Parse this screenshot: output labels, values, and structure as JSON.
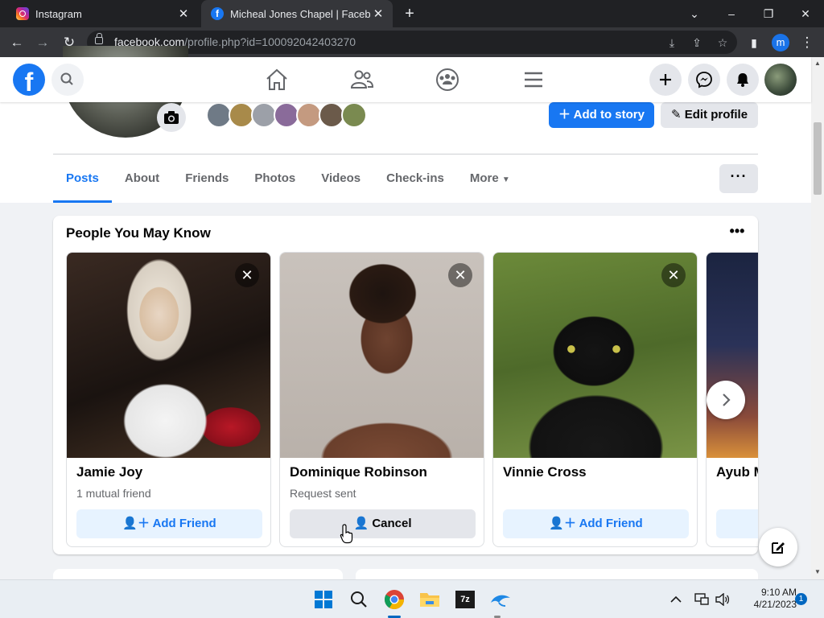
{
  "browser": {
    "tabs": [
      {
        "title": "Instagram"
      },
      {
        "title": "Micheal Jones Chapel | Facebook"
      }
    ],
    "url_host": "facebook.com",
    "url_path": "/profile.php?id=100092042403270",
    "profile_initial": "m"
  },
  "profile": {
    "add_story_label": "Add to story",
    "edit_profile_label": "Edit profile",
    "tabs": [
      "Posts",
      "About",
      "Friends",
      "Photos",
      "Videos",
      "Check-ins",
      "More"
    ],
    "active_tab": "Posts",
    "more_dots": "···"
  },
  "pymk": {
    "title": "People You May Know",
    "people": [
      {
        "name": "Jamie Joy",
        "subtitle": "1 mutual friend",
        "button": "Add Friend",
        "state": "add"
      },
      {
        "name": "Dominique Robinson",
        "subtitle": "Request sent",
        "button": "Cancel",
        "state": "cancel"
      },
      {
        "name": "Vinnie Cross",
        "subtitle": "",
        "button": "Add Friend",
        "state": "add"
      },
      {
        "name": "Ayub M",
        "subtitle": "",
        "button": "",
        "state": "add"
      }
    ]
  },
  "taskbar": {
    "time": "9:10 AM",
    "date": "4/21/2023",
    "notifications": "1"
  },
  "colors": {
    "fb_blue": "#1877f2",
    "page_bg": "#f0f2f5"
  }
}
